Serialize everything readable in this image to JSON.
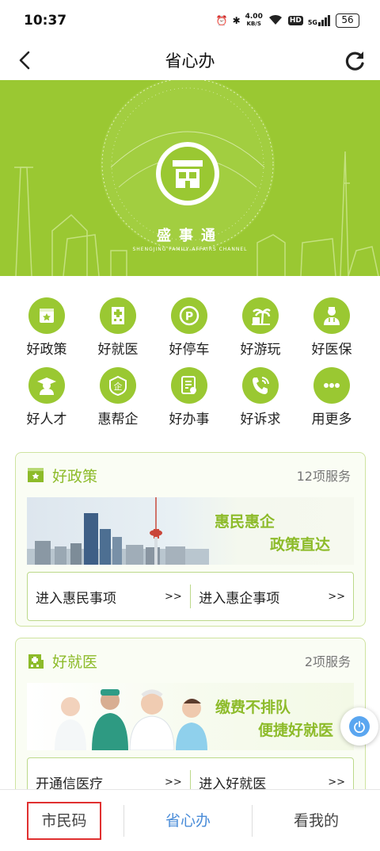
{
  "status_bar": {
    "time": "10:37",
    "net_speed_value": "4.00",
    "net_speed_unit": "KB/S",
    "hd": "HD",
    "signal": "5G",
    "battery": "56"
  },
  "nav": {
    "title": "省心办",
    "back_icon": "chevron-left-icon",
    "refresh_icon": "refresh-icon"
  },
  "banner": {
    "title": "盛事通",
    "subtitle": "SHENGJING FAMILY AFFAIRS CHANNEL"
  },
  "grid": [
    {
      "label": "好政策",
      "icon": "policy-icon"
    },
    {
      "label": "好就医",
      "icon": "hospital-icon"
    },
    {
      "label": "好停车",
      "icon": "parking-icon"
    },
    {
      "label": "好游玩",
      "icon": "travel-icon"
    },
    {
      "label": "好医保",
      "icon": "doctor-icon"
    },
    {
      "label": "好人才",
      "icon": "graduate-icon"
    },
    {
      "label": "惠帮企",
      "icon": "enterprise-icon"
    },
    {
      "label": "好办事",
      "icon": "document-icon"
    },
    {
      "label": "好诉求",
      "icon": "phone-icon"
    },
    {
      "label": "用更多",
      "icon": "more-icon"
    }
  ],
  "cards": [
    {
      "title": "好政策",
      "count": "12项服务",
      "slogan_1": "惠民惠企",
      "slogan_2": "政策直达",
      "link_1": "进入惠民事项",
      "link_2": "进入惠企事项",
      "arrow": ">>"
    },
    {
      "title": "好就医",
      "count": "2项服务",
      "slogan_1": "缴费不排队",
      "slogan_2": "便捷好就医",
      "link_1": "开通信医疗",
      "link_2": "进入好就医",
      "arrow": ">>"
    }
  ],
  "tabs": [
    {
      "label": "市民码"
    },
    {
      "label": "省心办"
    },
    {
      "label": "看我的"
    }
  ],
  "colors": {
    "brand_green": "#9ac832",
    "active_tab_blue": "#4a8cd8",
    "highlight_red": "#e03030"
  }
}
